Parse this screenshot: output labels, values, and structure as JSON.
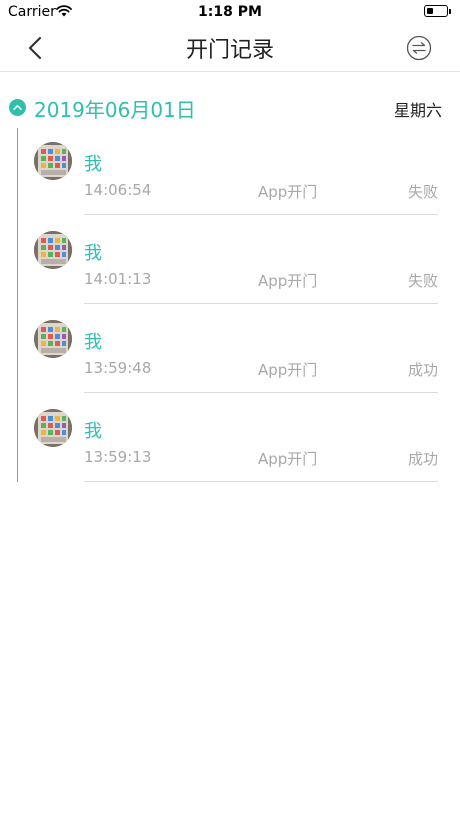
{
  "status_bar": {
    "carrier": "Carrier",
    "time": "1:18 PM"
  },
  "nav": {
    "title": "开门记录"
  },
  "date_group": {
    "date": "2019年06月01日",
    "weekday": "星期六"
  },
  "records": [
    {
      "name": "我",
      "time": "14:06:54",
      "method": "App开门",
      "result": "失败"
    },
    {
      "name": "我",
      "time": "14:01:13",
      "method": "App开门",
      "result": "失败"
    },
    {
      "name": "我",
      "time": "13:59:48",
      "method": "App开门",
      "result": "成功"
    },
    {
      "name": "我",
      "time": "13:59:13",
      "method": "App开门",
      "result": "成功"
    }
  ],
  "colors": {
    "accent": "#2fbfae",
    "muted_text": "#a8a8a8",
    "divider": "#dcdcdc"
  }
}
